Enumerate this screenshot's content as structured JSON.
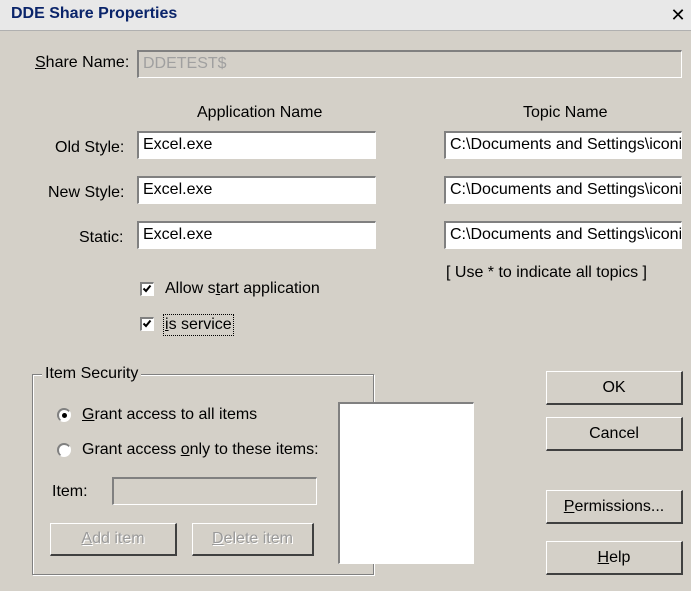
{
  "window": {
    "title": "DDE Share Properties",
    "close_glyph": "✕"
  },
  "share": {
    "label": "Share Name:",
    "value": "DDETEST$"
  },
  "columns": {
    "application": "Application Name",
    "topic": "Topic Name"
  },
  "rows": [
    {
      "label": "Old Style:",
      "app": "Excel.exe",
      "topic": "C:\\Documents and Settings\\iconi"
    },
    {
      "label": "New Style:",
      "app": "Excel.exe",
      "topic": "C:\\Documents and Settings\\iconi"
    },
    {
      "label": "Static:",
      "app": "Excel.exe",
      "topic": "C:\\Documents and Settings\\iconi"
    }
  ],
  "topics_hint": "[ Use * to indicate all topics ]",
  "options": {
    "allow_start": {
      "label": "Allow start application",
      "checked": true
    },
    "is_service": {
      "label": "is service",
      "checked": true
    }
  },
  "item_security": {
    "title": "Item Security",
    "grant_all": {
      "label": "Grant access to all items",
      "selected": true
    },
    "grant_some": {
      "label": "Grant access only to these items:",
      "selected": false
    },
    "item_label": "Item:",
    "item_value": "",
    "add_button": "Add item",
    "delete_button": "Delete item"
  },
  "buttons": {
    "ok": "OK",
    "cancel": "Cancel",
    "permissions": "Permissions...",
    "help": "Help"
  }
}
